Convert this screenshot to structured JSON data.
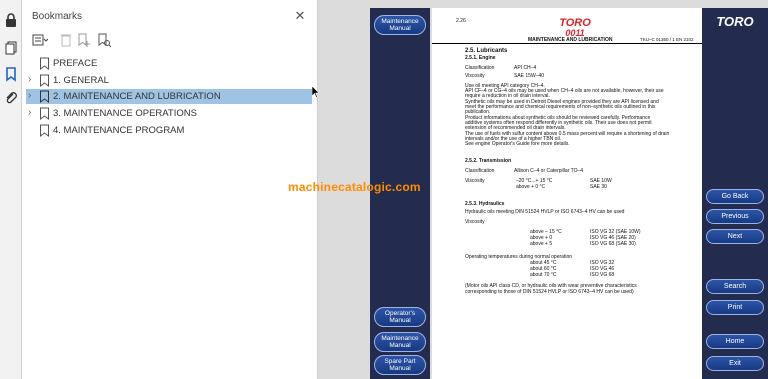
{
  "rail": {
    "icons": [
      "lock-icon",
      "pages-icon",
      "bookmark-icon",
      "paperclip-icon"
    ]
  },
  "bookmarks": {
    "title": "Bookmarks",
    "close": "✕",
    "items": [
      {
        "label": "PREFACE",
        "expandable": false,
        "selected": false
      },
      {
        "label": "1. GENERAL",
        "expandable": true,
        "selected": false
      },
      {
        "label": "2. MAINTENANCE AND LUBRICATION",
        "expandable": true,
        "selected": true
      },
      {
        "label": "3. MAINTENANCE OPERATIONS",
        "expandable": true,
        "selected": false
      },
      {
        "label": "4. MAINTENANCE PROGRAM",
        "expandable": false,
        "selected": false
      }
    ]
  },
  "watermark": "machinecatalogic.com",
  "nav_left": {
    "maintenance": "Maintenance Manual",
    "operators": "Operator's Manual",
    "maintenance2": "Maintenance Manual",
    "spare": "Spare Part Manual"
  },
  "nav_right": {
    "logo": "TORO",
    "go_back": "Go Back",
    "previous": "Previous",
    "next": "Next",
    "search": "Search",
    "print": "Print",
    "home": "Home",
    "exit": "Exit"
  },
  "page": {
    "page_number": "2.26",
    "logo_top": "TORO",
    "logo_bottom": "0011",
    "section_header": "MAINTENANCE AND LUBRICATION",
    "doc_code": "TKU–C 01360 / 1 EN 2102",
    "h1": "2.5.  Lubricants",
    "h2": "2.5.1.  Engine",
    "class_label": "Classification",
    "class_value": "API CH–4",
    "visc_label": "Viscosity",
    "visc_value": "SAE 15W–40",
    "p1": "Use oil meeting API category CH–4.",
    "p2": "API CF–4 or CG–4 oils may be used when CH–4 oils are not available, however, their use",
    "p3": "require a reduction in oil drain interval.",
    "p4": "Synthetic oils may be used in Detroit Diesel engines provided they are API licensed and",
    "p5": "meet the performance and chemical requirements of non–synthetic oils outlined in this",
    "p6": "publication.",
    "p7": "Product informations about synthetic oils should be reviewed carefully. Performance",
    "p8": "additive systems often respond differently in synthetic oils. Their use does not permit",
    "p9": "extension of recommended oil drain intervals.",
    "p10": "The use of fuels with sulfur content above 0.5 mass percent will require a shortening of drain",
    "p11": "intervals and/or the use of a higher TBN oil.",
    "p12": "See engine Operator's Guide fore more details.",
    "h3": "2.5.2.  Transmission",
    "tclass_label": "Classification",
    "tclass_value": "Allison C–4 or Caterpillar TO–4",
    "tvisc_label": "Viscosity",
    "tv1_temp": "–20 °C...+ 15 °C",
    "tv1_oil": "SAE 10W",
    "tv2_temp": "above + 0 °C",
    "tv2_oil": "SAE 30",
    "h4": "2.5.3.  Hydraulics",
    "h_intro": "Hydraulic oils meeting DIN 51524 HVLP or ISO 6743–4 HV can be used",
    "h_visc": "Viscosity",
    "hv1_temp": "above – 15 °C",
    "hv1_oil": "ISO VG 32   (SAE 10W)",
    "hv2_temp": "above + 0",
    "hv2_oil": "ISO VG 46   (SAE 20)",
    "hv3_temp": "above + 5",
    "hv3_oil": "ISO VG 68   (SAE 30)",
    "op_label": "Operating temperatures during normal operation",
    "op1_temp": "about 45 °C",
    "op1_oil": "ISO VG 32",
    "op2_temp": "about 60 °C",
    "op2_oil": "ISO VG 46",
    "op3_temp": "about 70 °C",
    "op3_oil": "ISO VG 68",
    "note1": "(Motor oils API class CD, or hydraulic oils with wear preventive characteristics",
    "note2": "corresponding to those of DIN 51524 HVLP or ISO 6743–4 HV can be used)"
  },
  "colors": {
    "nav_bg": "#232b4e",
    "button": "#1f4593",
    "selection": "#9fc3e3",
    "watermark": "#ff8c00",
    "logo_red": "#d9262c"
  }
}
